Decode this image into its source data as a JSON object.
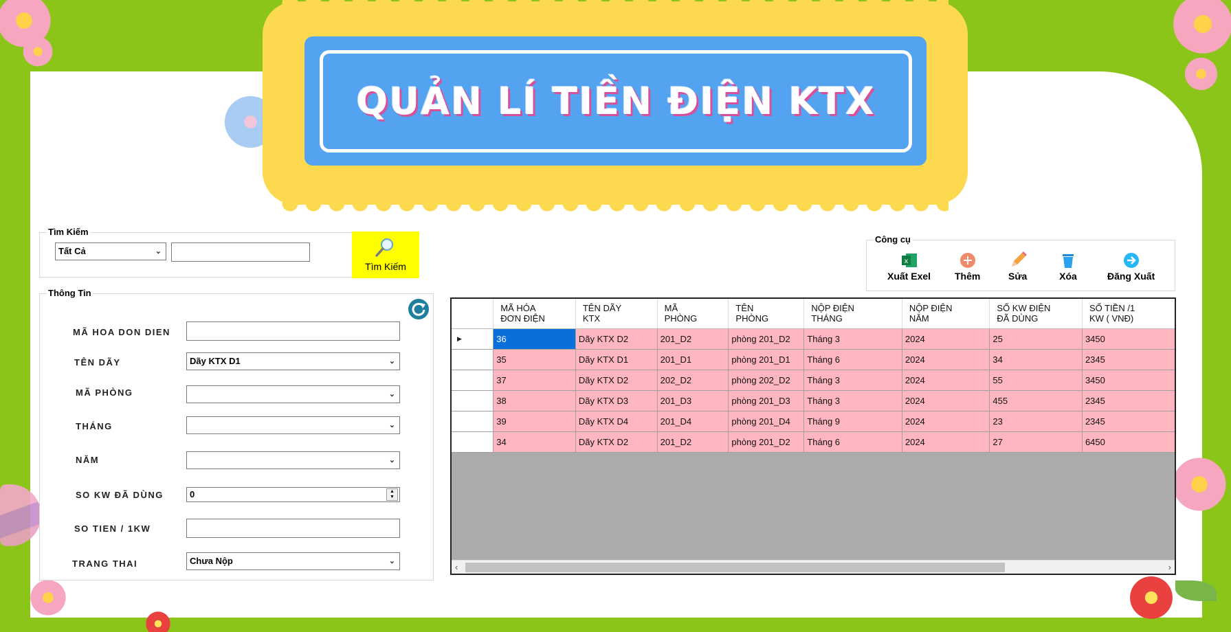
{
  "banner": {
    "title": "QUẢN LÍ TIỀN ĐIỆN KTX"
  },
  "search": {
    "legend": "Tìm Kiếm",
    "filter_value": "Tất Cả",
    "query_value": "",
    "button_label": "Tìm Kiếm"
  },
  "info": {
    "legend": "Thông Tin",
    "fields": {
      "ma_hoa_don": {
        "label": "MÃ HOA DON DIEN",
        "value": ""
      },
      "ten_day": {
        "label": "TÊN DÃY",
        "value": "Dãy KTX D1"
      },
      "ma_phong": {
        "label": "MÃ PHÒNG",
        "value": ""
      },
      "thang": {
        "label": "THÁNG",
        "value": ""
      },
      "nam": {
        "label": "NĂM",
        "value": ""
      },
      "so_kw": {
        "label": "SO KW ĐÃ DÙNG",
        "value": "0"
      },
      "so_tien": {
        "label": "SO TIEN / 1KW",
        "value": ""
      },
      "trang_thai": {
        "label": "TRANG THAI",
        "value": "Chưa Nộp"
      }
    }
  },
  "tools": {
    "legend": "Công cụ",
    "export": "Xuất Exel",
    "add": "Thêm",
    "edit": "Sửa",
    "delete": "Xóa",
    "logout": "Đăng Xuất"
  },
  "grid": {
    "columns": [
      [
        "MÃ HÓA",
        "ĐƠN ĐIỆN"
      ],
      [
        "TÊN DÃY",
        "KTX"
      ],
      [
        "MÃ",
        "PHÒNG"
      ],
      [
        "TÊN",
        "PHÒNG"
      ],
      [
        "NỘP ĐIỆN",
        "THÁNG"
      ],
      [
        "NỘP ĐIỆN",
        "NĂM"
      ],
      [
        "SỐ KW ĐIỆN",
        "ĐÃ DÙNG"
      ],
      [
        "SỐ TIỀN /1",
        "KW ( VNĐ)"
      ]
    ],
    "rows": [
      [
        "36",
        "Dãy KTX D2",
        "201_D2",
        "phòng 201_D2",
        "Tháng 3",
        "2024",
        "25",
        "3450"
      ],
      [
        "35",
        "Dãy KTX D1",
        "201_D1",
        "phòng 201_D1",
        "Tháng 6",
        "2024",
        "34",
        "2345"
      ],
      [
        "37",
        "Dãy KTX D2",
        "202_D2",
        "phòng 202_D2",
        "Tháng 3",
        "2024",
        "55",
        "3450"
      ],
      [
        "38",
        "Dãy KTX D3",
        "201_D3",
        "phòng 201_D3",
        "Tháng 3",
        "2024",
        "455",
        "2345"
      ],
      [
        "39",
        "Dãy KTX D4",
        "201_D4",
        "phòng 201_D4",
        "Tháng 9",
        "2024",
        "23",
        "2345"
      ],
      [
        "34",
        "Dãy KTX D2",
        "201_D2",
        "phòng 201_D2",
        "Tháng 6",
        "2024",
        "27",
        "6450"
      ]
    ]
  }
}
